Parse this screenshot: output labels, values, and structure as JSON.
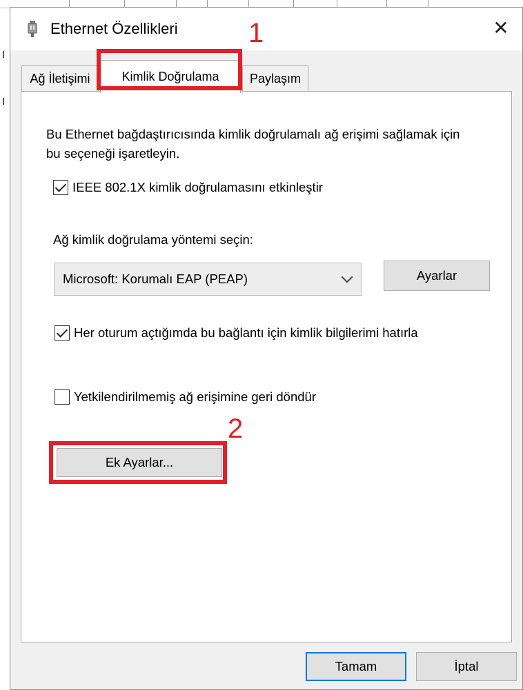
{
  "window": {
    "title": "Ethernet Özellikleri",
    "close_symbol": "✕"
  },
  "tabs": [
    {
      "label": "Ağ İletişimi"
    },
    {
      "label": "Kimlik Doğrulama"
    },
    {
      "label": "Paylaşım"
    }
  ],
  "active_tab": "Kimlik Doğrulama",
  "annotations": {
    "one": "1",
    "two": "2"
  },
  "auth": {
    "description": "Bu Ethernet bağdaştırıcısında kimlik doğrulamalı ağ erişimi sağlamak için bu seçeneği işaretleyin.",
    "enable_8021x": {
      "label": "IEEE 802.1X kimlik doğrulamasını etkinleştir",
      "checked": true
    },
    "method_label": "Ağ kimlik doğrulama yöntemi seçin:",
    "method_value": "Microsoft: Korumalı EAP (PEAP)",
    "settings_button": "Ayarlar",
    "remember": {
      "label": "Her oturum açtığımda bu bağlantı için kimlik bilgilerimi hatırla",
      "checked": true
    },
    "fallback": {
      "label": "Yetkilendirilmemiş ağ erişimine geri döndür",
      "checked": false
    },
    "additional_button": "Ek Ayarlar..."
  },
  "footer": {
    "ok": "Tamam",
    "cancel": "İptal"
  },
  "colors": {
    "annotation_red": "#e0202a",
    "focus_blue": "#0078d7",
    "panel_bg": "#ffffff",
    "window_bg": "#f0f0f0"
  },
  "icons": [
    "ethernet-adapter-icon",
    "close-icon",
    "checkmark-icon",
    "chevron-down-icon"
  ]
}
